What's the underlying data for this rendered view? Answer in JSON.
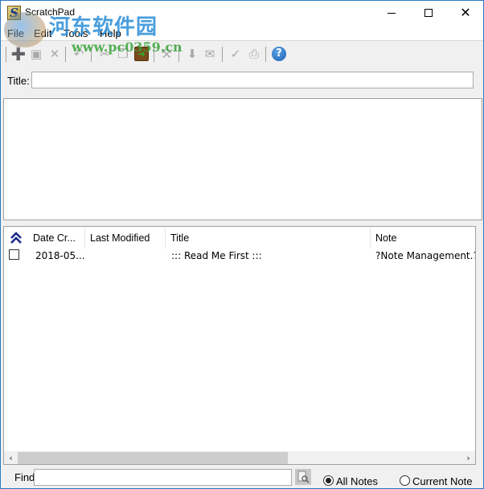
{
  "window": {
    "title": "ScratchPad",
    "app_icon_glyph": "S",
    "border_color": "#2b79c2",
    "controls": {
      "minimize": "minimize",
      "maximize": "maximize",
      "close": "✕"
    }
  },
  "menu": {
    "items": [
      {
        "label": "File"
      },
      {
        "label": "Edit"
      },
      {
        "label": "Tools"
      },
      {
        "label": "Help"
      }
    ]
  },
  "toolbar": {
    "buttons": [
      {
        "name": "new-note",
        "icon": "new-document-icon",
        "glyph": "➕",
        "enabled": false
      },
      {
        "name": "save",
        "icon": "save-icon",
        "glyph": "▣",
        "enabled": false
      },
      {
        "name": "delete",
        "icon": "delete-icon",
        "glyph": "✕",
        "enabled": false
      },
      {
        "name": "undo",
        "icon": "undo-icon",
        "glyph": "↶",
        "enabled": false
      },
      {
        "name": "cut",
        "icon": "scissors-icon",
        "glyph": "✂",
        "enabled": false
      },
      {
        "name": "copy",
        "icon": "copy-icon",
        "glyph": "❐",
        "enabled": false
      },
      {
        "name": "paste",
        "icon": "paste-icon",
        "glyph": "➜",
        "enabled": true
      },
      {
        "name": "options",
        "icon": "tools-icon",
        "glyph": "⚒",
        "enabled": false
      },
      {
        "name": "import",
        "icon": "import-icon",
        "glyph": "⬇",
        "enabled": false
      },
      {
        "name": "email",
        "icon": "email-icon",
        "glyph": "✉",
        "enabled": false
      },
      {
        "name": "spellcheck",
        "icon": "spellcheck-icon",
        "glyph": "✓",
        "enabled": false
      },
      {
        "name": "print",
        "icon": "print-icon",
        "glyph": "⎙",
        "enabled": false
      },
      {
        "name": "help",
        "icon": "help-icon",
        "glyph": "?",
        "enabled": true
      }
    ]
  },
  "editor": {
    "title_label": "Title:",
    "title_value": "",
    "body_value": ""
  },
  "list": {
    "sort_icon": "double-chevron-up-icon",
    "columns": [
      {
        "label": "Date Cr..."
      },
      {
        "label": "Last Modified"
      },
      {
        "label": "Title"
      },
      {
        "label": "Note"
      }
    ],
    "rows": [
      {
        "checked": false,
        "date_created": "2018-05...",
        "last_modified": "",
        "title": "::: Read Me First :::",
        "note": "?Note Management.?F"
      }
    ]
  },
  "find": {
    "label": "Find",
    "value": "",
    "button_icon": "find-icon",
    "scope_options": [
      {
        "label": "All Notes",
        "checked": true
      },
      {
        "label": "Current Note",
        "checked": false
      }
    ]
  },
  "watermark": {
    "text_cn": "河东软件园",
    "url": "www.pc0359.cn"
  }
}
